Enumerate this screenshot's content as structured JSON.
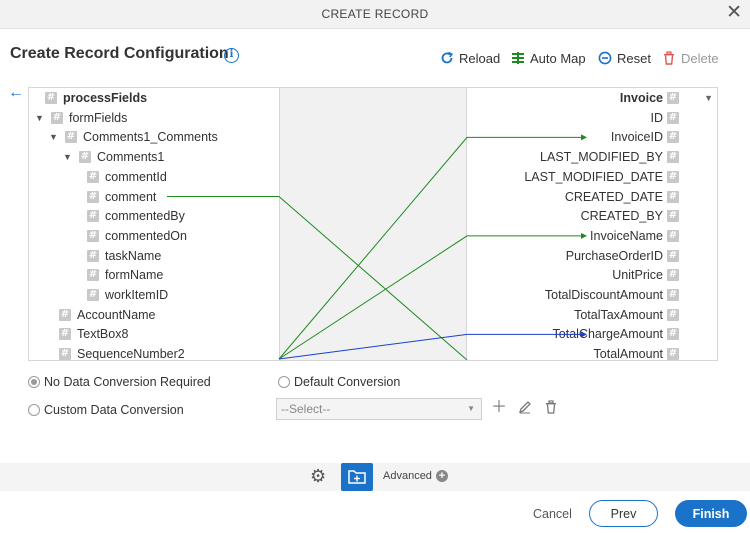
{
  "window": {
    "title": "CREATE RECORD",
    "close_glyph": "✕"
  },
  "page": {
    "title": "Create Record Configuration",
    "info_glyph": "i"
  },
  "toolbar": {
    "reload": "Reload",
    "automap": "Auto Map",
    "reset": "Reset",
    "delete": "Delete"
  },
  "left_tree": [
    {
      "label": "processFields",
      "bold": true,
      "caret": false
    },
    {
      "label": "formFields",
      "bold": false,
      "caret": true
    },
    {
      "label": "Comments1_Comments",
      "bold": false,
      "caret": true
    },
    {
      "label": "Comments1",
      "bold": false,
      "caret": true
    },
    {
      "label": "commentId",
      "bold": false,
      "caret": false
    },
    {
      "label": "comment",
      "bold": false,
      "caret": false
    },
    {
      "label": "commentedBy",
      "bold": false,
      "caret": false
    },
    {
      "label": "commentedOn",
      "bold": false,
      "caret": false
    },
    {
      "label": "taskName",
      "bold": false,
      "caret": false
    },
    {
      "label": "formName",
      "bold": false,
      "caret": false
    },
    {
      "label": "workItemID",
      "bold": false,
      "caret": false
    },
    {
      "label": "AccountName",
      "bold": false,
      "caret": false
    },
    {
      "label": "TextBox8",
      "bold": false,
      "caret": false
    },
    {
      "label": "SequenceNumber2",
      "bold": false,
      "caret": false
    }
  ],
  "right_tree": [
    {
      "label": "Invoice",
      "bold": true
    },
    {
      "label": "ID",
      "bold": false
    },
    {
      "label": "InvoiceID",
      "bold": false
    },
    {
      "label": "LAST_MODIFIED_BY",
      "bold": false
    },
    {
      "label": "LAST_MODIFIED_DATE",
      "bold": false
    },
    {
      "label": "CREATED_DATE",
      "bold": false
    },
    {
      "label": "CREATED_BY",
      "bold": false
    },
    {
      "label": "InvoiceName",
      "bold": false
    },
    {
      "label": "PurchaseOrderID",
      "bold": false
    },
    {
      "label": "UnitPrice",
      "bold": false
    },
    {
      "label": "TotalDiscountAmount",
      "bold": false
    },
    {
      "label": "TotalTaxAmount",
      "bold": false
    },
    {
      "label": "TotalChargeAmount",
      "bold": false
    },
    {
      "label": "TotalAmount",
      "bold": false
    }
  ],
  "mappings": [
    {
      "from": "comment",
      "to": "TotalAmount",
      "color": "#1f8a1f"
    },
    {
      "from": "SequenceNumber2",
      "to": "InvoiceID",
      "color": "#1f8a1f"
    },
    {
      "from": "SequenceNumber2",
      "to": "InvoiceName",
      "color": "#1f8a1f"
    },
    {
      "from": "SequenceNumber2",
      "to": "TotalChargeAmount",
      "color": "#1a3fd1"
    }
  ],
  "conversion": {
    "no_conversion": "No Data Conversion Required",
    "default_conversion": "Default Conversion",
    "custom_conversion": "Custom Data Conversion",
    "select_value": "--Select--",
    "selected": "no_conversion"
  },
  "footer": {
    "advanced": "Advanced",
    "cancel": "Cancel",
    "prev": "Prev",
    "finish": "Finish"
  },
  "colors": {
    "accent": "#1a73c8",
    "map_green": "#1f8a1f",
    "map_blue": "#1a3fd1"
  }
}
